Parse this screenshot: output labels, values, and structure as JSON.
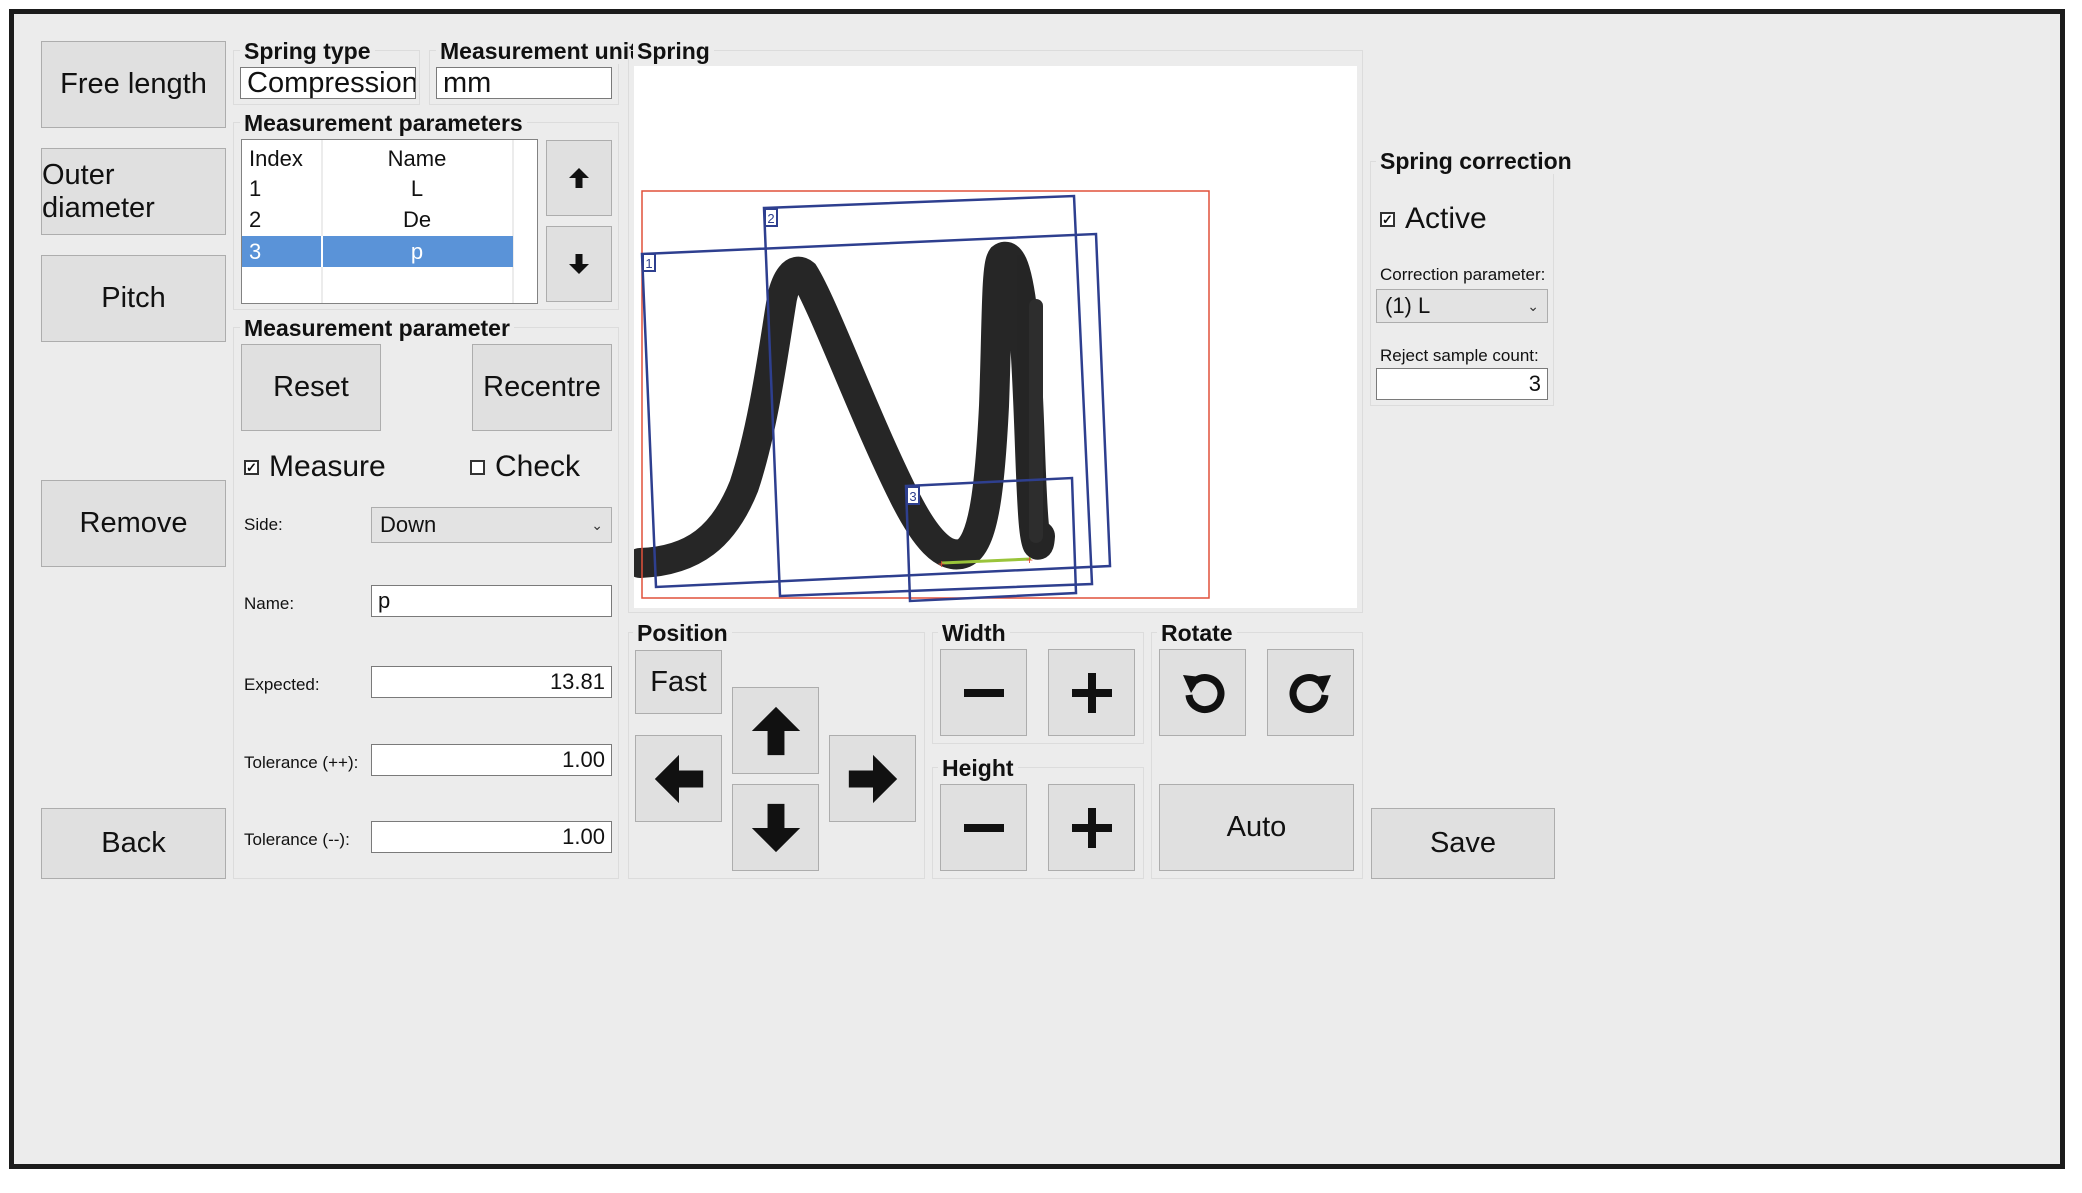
{
  "left_buttons": {
    "free_length": "Free length",
    "outer_diameter": "Outer diameter",
    "pitch": "Pitch",
    "remove": "Remove",
    "back": "Back"
  },
  "spring_type": {
    "title": "Spring type",
    "value": "Compression"
  },
  "measurement_unit": {
    "title": "Measurement unit",
    "value": "mm"
  },
  "measurement_parameters": {
    "title": "Measurement parameters",
    "columns": [
      "Index",
      "Name"
    ],
    "rows": [
      {
        "index": "1",
        "name": "L"
      },
      {
        "index": "2",
        "name": "De"
      },
      {
        "index": "3",
        "name": "p"
      }
    ],
    "selected_index": "3"
  },
  "measurement_parameter": {
    "title": "Measurement parameter",
    "reset": "Reset",
    "recentre": "Recentre",
    "measure": {
      "label": "Measure",
      "checked": true
    },
    "check": {
      "label": "Check",
      "checked": false
    },
    "side_label": "Side:",
    "side_value": "Down",
    "name_label": "Name:",
    "name_value": "p",
    "expected_label": "Expected:",
    "expected_value": "13.81",
    "tol_plus_label": "Tolerance (++):",
    "tol_plus_value": "1.00",
    "tol_minus_label": "Tolerance (--):",
    "tol_minus_value": "1.00"
  },
  "spring": {
    "title": "Spring",
    "roi_labels": [
      "1",
      "2",
      "3"
    ],
    "colors": {
      "roi": "#2e3f8f",
      "frame": "#e0503a",
      "measure_line": "#9ac43a"
    }
  },
  "position": {
    "title": "Position",
    "fast": "Fast"
  },
  "width": {
    "title": "Width"
  },
  "height": {
    "title": "Height"
  },
  "rotate": {
    "title": "Rotate",
    "auto": "Auto"
  },
  "spring_correction": {
    "title": "Spring correction",
    "active": {
      "label": "Active",
      "checked": true
    },
    "correction_label": "Correction parameter:",
    "correction_value": "(1) L",
    "reject_label": "Reject sample count:",
    "reject_value": "3"
  },
  "save": "Save",
  "icons": {
    "up": "arrow-up-icon",
    "down": "arrow-down-icon",
    "left": "arrow-left-icon",
    "right": "arrow-right-icon",
    "minus": "minus-icon",
    "plus": "plus-icon",
    "rotate_left": "rotate-ccw-icon",
    "rotate_right": "rotate-cw-icon",
    "chevron": "chevron-down-icon"
  }
}
